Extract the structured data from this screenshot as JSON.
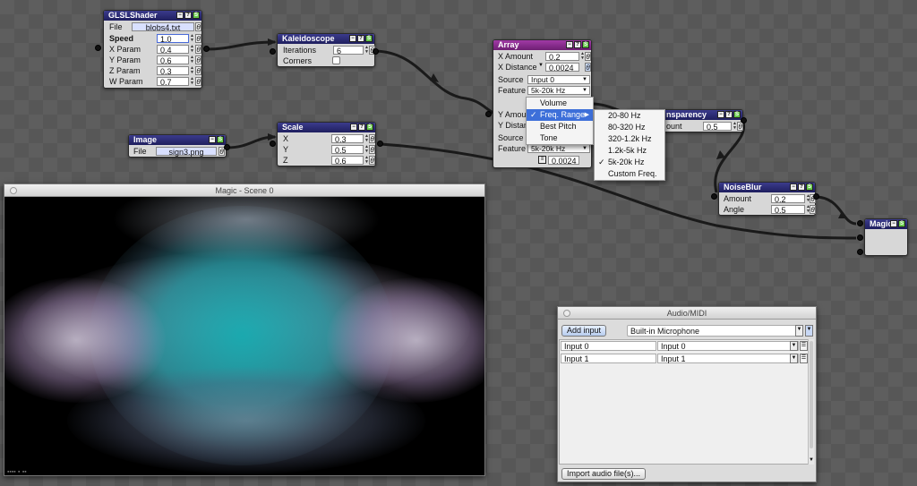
{
  "nodes": {
    "glsl": {
      "title": "GLSLShader",
      "file_label": "File",
      "file_value": "blobs4.txt",
      "params": [
        {
          "label": "Speed",
          "value": "1.0"
        },
        {
          "label": "X Param",
          "value": "0.4"
        },
        {
          "label": "Y Param",
          "value": "0.6"
        },
        {
          "label": "Z Param",
          "value": "0.3"
        },
        {
          "label": "W Param",
          "value": "0.7"
        }
      ]
    },
    "kaleido": {
      "title": "Kaleidoscope",
      "iterations_label": "Iterations",
      "iterations_value": "6",
      "corners_label": "Corners"
    },
    "image": {
      "title": "Image",
      "file_label": "File",
      "file_value": "sign3.png"
    },
    "scale": {
      "title": "Scale",
      "params": [
        {
          "label": "X",
          "value": "0.3"
        },
        {
          "label": "Y",
          "value": "0.5"
        },
        {
          "label": "Z",
          "value": "0.6"
        }
      ]
    },
    "array": {
      "title": "Array",
      "x_amount_label": "X Amount",
      "x_amount_value": "0.2",
      "x_distance_label": "X Distance",
      "x_distance_value": "0.0024",
      "source_label": "Source",
      "source_value": "Input 0",
      "feature_label": "Feature",
      "feature_value": "5k-20k Hz",
      "y_amount_label": "Y Amount",
      "y_distance_label": "Y Distan",
      "source2_label": "Source",
      "feature2_label": "Feature",
      "feature2_value": "5k-20k Hz",
      "bottom_value": "0.0024"
    },
    "transparency": {
      "title": "nsparency",
      "amount_label": "ount",
      "amount_value": "0.5"
    },
    "noiseblur": {
      "title": "NoiseBlur",
      "params": [
        {
          "label": "Amount",
          "value": "0.2"
        },
        {
          "label": "Angle",
          "value": "0.5"
        }
      ]
    },
    "magic": {
      "title": "Magic"
    }
  },
  "feature_menu": {
    "items": [
      "Volume",
      "Freq. Range",
      "Best Pitch",
      "Tone"
    ],
    "active": "Freq. Range"
  },
  "freq_submenu": {
    "items": [
      "20-80 Hz",
      "80-320 Hz",
      "320-1.2k Hz",
      "1.2k-5k Hz",
      "5k-20k Hz",
      "Custom Freq."
    ],
    "checked": "5k-20k Hz"
  },
  "scene_window": {
    "title": "Magic - Scene 0"
  },
  "audio_window": {
    "title": "Audio/MIDI",
    "add_input_label": "Add input",
    "device_value": "Built-in Microphone",
    "inputs": [
      {
        "name": "Input 0",
        "source": "Input 0"
      },
      {
        "name": "Input 1",
        "source": "Input 1"
      }
    ],
    "import_label": "Import audio file(s)..."
  },
  "icons": {
    "theta": "θ",
    "up_down": "⇕"
  },
  "colors": {
    "node_header": "#1f1f5f",
    "array_header": "#8a2a90",
    "menu_highlight": "#3d6fd9"
  }
}
